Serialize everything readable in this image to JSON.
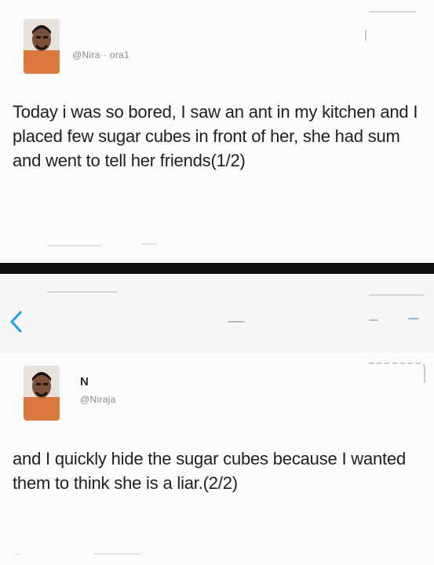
{
  "tweets": [
    {
      "display_name": "",
      "handle": "@Nira·· ora1",
      "text": "Today i was so bored, I saw an ant in my kitchen and I placed few sugar cubes in front of her, she had sum and went to tell her friends(1/2)"
    },
    {
      "display_name": "N",
      "handle": "@Niraja",
      "text": "and I quickly hide the sugar cubes because I wanted them to think she is a liar.(2/2)"
    }
  ],
  "nav": {
    "back_icon": "chevron-left-icon"
  },
  "colors": {
    "accent": "#1da1f2",
    "avatar_bg": "#d9793f",
    "divider": "#111111"
  }
}
